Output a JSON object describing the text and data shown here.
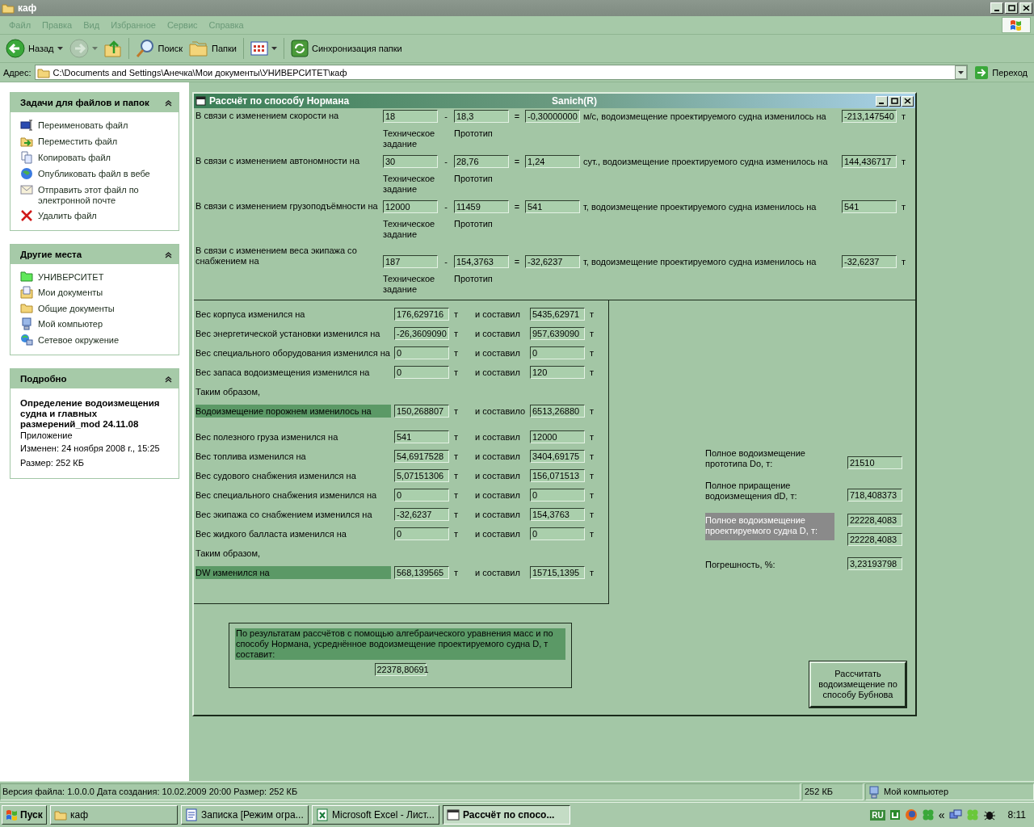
{
  "window": {
    "title": "каф"
  },
  "menu": [
    "Файл",
    "Правка",
    "Вид",
    "Избранное",
    "Сервис",
    "Справка"
  ],
  "toolbar": [
    {
      "kind": "back",
      "label": "Назад",
      "disabled": false
    },
    {
      "kind": "forward",
      "disabled": true
    },
    {
      "kind": "up",
      "disabled": false
    },
    {
      "kind": "search",
      "label": "Поиск",
      "disabled": false
    },
    {
      "kind": "folders",
      "label": "Папки",
      "disabled": false
    },
    {
      "kind": "views",
      "disabled": false
    },
    {
      "kind": "sync",
      "label": "Синхронизация папки",
      "disabled": false
    }
  ],
  "address": {
    "label": "Адрес:",
    "value": "C:\\Documents and Settings\\Анечка\\Мои документы\\УНИВЕРСИТЕТ\\каф",
    "go": "Переход"
  },
  "sidebar": {
    "panels": [
      {
        "title": "Задачи для файлов и папок",
        "items": [
          {
            "kind": "rename",
            "label": "Переименовать файл"
          },
          {
            "kind": "move",
            "label": "Переместить файл"
          },
          {
            "kind": "copy",
            "label": "Копировать файл"
          },
          {
            "kind": "publish",
            "label": "Опубликовать файл в вебе"
          },
          {
            "kind": "email",
            "label": "Отправить этот файл по электронной почте"
          },
          {
            "kind": "delete",
            "label": "Удалить файл"
          }
        ]
      },
      {
        "title": "Другие места",
        "items": [
          {
            "kind": "folder-green",
            "label": "УНИВЕРСИТЕТ"
          },
          {
            "kind": "documents",
            "label": "Мои документы"
          },
          {
            "kind": "folder",
            "label": "Общие документы"
          },
          {
            "kind": "computer",
            "label": "Мой компьютер"
          },
          {
            "kind": "network",
            "label": "Сетевое окружение"
          }
        ]
      }
    ],
    "details": {
      "title": "Подробно",
      "name": "Определение водоизмещения судна и главных размерений_mod 24.11.08",
      "type": "Приложение",
      "modified": "Изменен: 24 ноября 2008 г., 15:25",
      "size": "Размер: 252 КБ"
    }
  },
  "form": {
    "title": "Рассчёт по способу Нормана",
    "subtitle": "Sanich(R)",
    "changes": [
      {
        "label": "В связи с изменением скорости на",
        "spec": "18",
        "minus": "-",
        "proto": "18,3",
        "equals": "=",
        "diff": "-0,30000000",
        "text": "м/с, водоизмещение проектируемого судна изменилось на",
        "result": "-213,147540",
        "unit": "т",
        "spec_caption": "Техническое задание",
        "proto_caption": "Прототип"
      },
      {
        "label": "В связи с изменением автономности на",
        "spec": "30",
        "minus": "-",
        "proto": "28,76",
        "equals": "=",
        "diff": "1,24",
        "text": "сут., водоизмещение проектируемого судна изменилось на",
        "result": "144,436717",
        "unit": "т",
        "spec_caption": "Техническое задание",
        "proto_caption": "Прототип"
      },
      {
        "label": "В связи с изменением грузоподъёмности на",
        "spec": "12000",
        "minus": "-",
        "proto": "11459",
        "equals": "=",
        "diff": "541",
        "text": "т, водоизмещение проектируемого судна изменилось на",
        "result": "541",
        "unit": "т",
        "spec_caption": "Техническое задание",
        "proto_caption": "Прототип"
      },
      {
        "label": "В связи с изменением веса экипажа со снабжением на",
        "spec": "187",
        "minus": "-",
        "proto": "154,3763",
        "equals": "=",
        "diff": "-32,6237",
        "text": "т, водоизмещение проектируемого судна изменилось на",
        "result": "-32,6237",
        "unit": "т",
        "spec_caption": "Техническое задание",
        "proto_caption": "Прототип"
      }
    ],
    "weight_groups": [
      [
        {
          "kind": "row",
          "label": "Вес корпуса изменился на",
          "change": "176,629716",
          "unit": "т",
          "verb": "и составил",
          "total": "5435,62971",
          "total_unit": "т",
          "highlighted": false
        },
        {
          "kind": "row",
          "label": "Вес энергетической установки изменился на",
          "change": "-26,3609090",
          "unit": "т",
          "verb": "и составил",
          "total": "957,639090",
          "total_unit": "т",
          "highlighted": false
        },
        {
          "kind": "row",
          "label": "Вес специального оборудования изменился на",
          "change": "0",
          "unit": "т",
          "verb": "и составил",
          "total": "0",
          "total_unit": "т",
          "highlighted": false
        },
        {
          "kind": "row",
          "label": "Вес запаса водоизмещения изменился на",
          "change": "0",
          "unit": "т",
          "verb": "и составил",
          "total": "120",
          "total_unit": "т",
          "highlighted": false
        },
        {
          "kind": "note",
          "text": "Таким образом,"
        },
        {
          "kind": "row",
          "label": "Водоизмещение порожнем изменилось на",
          "change": "150,268807",
          "unit": "т",
          "verb": "и составило",
          "total": "6513,26880",
          "total_unit": "т",
          "highlighted": true
        }
      ],
      [
        {
          "kind": "row",
          "label": "Вес полезного груза изменился на",
          "change": "541",
          "unit": "т",
          "verb": "и составил",
          "total": "12000",
          "total_unit": "т",
          "highlighted": false
        },
        {
          "kind": "row",
          "label": "Вес топлива изменился на",
          "change": "54,6917528",
          "unit": "т",
          "verb": "и составил",
          "total": "3404,69175",
          "total_unit": "т",
          "highlighted": false
        },
        {
          "kind": "row",
          "label": "Вес судового снабжения изменился на",
          "change": "5,07151306",
          "unit": "т",
          "verb": "и составил",
          "total": "156,071513",
          "total_unit": "т",
          "highlighted": false
        },
        {
          "kind": "row",
          "label": "Вес специального снабжения изменился на",
          "change": "0",
          "unit": "т",
          "verb": "и составил",
          "total": "0",
          "total_unit": "т",
          "highlighted": false
        },
        {
          "kind": "row",
          "label": "Вес экипажа со снабжением изменился на",
          "change": "-32,6237",
          "unit": "т",
          "verb": "и составил",
          "total": "154,3763",
          "total_unit": "т",
          "highlighted": false
        },
        {
          "kind": "row",
          "label": "Вес жидкого балласта изменился на",
          "change": "0",
          "unit": "т",
          "verb": "и составил",
          "total": "0",
          "total_unit": "т",
          "highlighted": false
        },
        {
          "kind": "note",
          "text": "Таким образом,"
        },
        {
          "kind": "row",
          "label": "DW изменился на",
          "change": "568,139565",
          "unit": "т",
          "verb": "и составил",
          "total": "15715,1395",
          "total_unit": "т",
          "highlighted": true
        }
      ]
    ],
    "summary": [
      {
        "label": "Полное водоизмещение прототипа Do, т:",
        "values": [
          "21510"
        ],
        "highlighted": false
      },
      {
        "label": "Полное приращение водоизмещения dD, т:",
        "values": [
          "718,408373"
        ],
        "highlighted": false
      },
      {
        "label": "Полное водоизмещение проектируемого судна D, т:",
        "values": [
          "22228,4083",
          "22228,4083"
        ],
        "highlighted": true
      },
      {
        "label": "Погрешность, %:",
        "values": [
          "3,23193798"
        ],
        "highlighted": false
      }
    ],
    "result": {
      "text": "По результатам рассчётов с помощью алгебраического уравнения масс и по способу Нормана, усреднённое водоизмещение проектируемого судна D, т составит:",
      "value": "22378,80691"
    },
    "button": "Рассчитать водоизмещение по способу Бубнова"
  },
  "status_bar": [
    "Версия файла: 1.0.0.0 Дата создания: 10.02.2009 20:00 Размер: 252 КБ",
    "252 КБ",
    "Мой компьютер"
  ],
  "taskbar": {
    "start": "Пуск",
    "tasks": [
      {
        "kind": "folder",
        "label": "каф",
        "selected": false
      },
      {
        "kind": "word",
        "label": "Записка [Режим огра...",
        "selected": false
      },
      {
        "kind": "excel",
        "label": "Microsoft Excel - Лист...",
        "selected": false
      },
      {
        "kind": "form",
        "label": "Рассчёт по спосо...",
        "selected": true
      }
    ],
    "language": "RU",
    "expander": "«",
    "clock": "8:11"
  }
}
